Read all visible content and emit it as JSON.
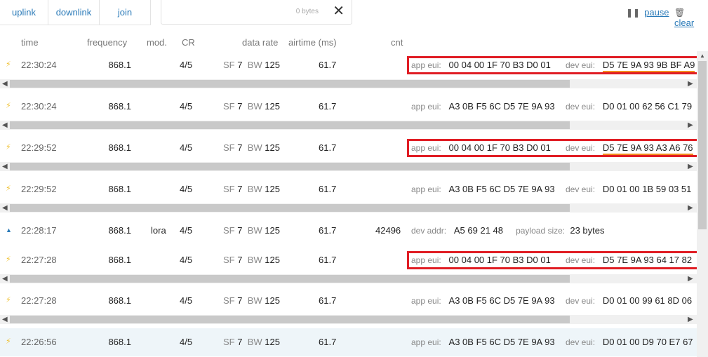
{
  "tabs": [
    {
      "label": "uplink"
    },
    {
      "label": "downlink"
    },
    {
      "label": "join"
    }
  ],
  "filter": {
    "bytes": "0 bytes",
    "clear": "✕"
  },
  "controls": {
    "pause": "pause",
    "clear": "clear"
  },
  "columns": {
    "time": "time",
    "frequency": "frequency",
    "mod": "mod.",
    "cr": "CR",
    "data_rate": "data rate",
    "airtime": "airtime (ms)",
    "cnt": "cnt"
  },
  "labels": {
    "app_eui": "app eui:",
    "dev_eui": "dev eui:",
    "dev_addr": "dev addr:",
    "payload_size": "payload size:",
    "sf": "SF",
    "bw": "BW"
  },
  "rows": [
    {
      "type": "join",
      "time": "22:30:24",
      "freq": "868.1",
      "mod": "",
      "cr": "4/5",
      "sf": "7",
      "bw": "125",
      "airtime": "61.7",
      "cnt": "",
      "app_eui": "00 04 00 1F 70 B3 D0 01",
      "dev_eui": "D5 7E 9A 93 9B BF A9"
    },
    {
      "type": "join",
      "time": "22:30:24",
      "freq": "868.1",
      "mod": "",
      "cr": "4/5",
      "sf": "7",
      "bw": "125",
      "airtime": "61.7",
      "cnt": "",
      "app_eui": "A3 0B F5 6C D5 7E 9A 93",
      "dev_eui": "D0 01 00 62 56 C1 79"
    },
    {
      "type": "join",
      "time": "22:29:52",
      "freq": "868.1",
      "mod": "",
      "cr": "4/5",
      "sf": "7",
      "bw": "125",
      "airtime": "61.7",
      "cnt": "",
      "app_eui": "00 04 00 1F 70 B3 D0 01",
      "dev_eui": "D5 7E 9A 93 A3 A6 76"
    },
    {
      "type": "join",
      "time": "22:29:52",
      "freq": "868.1",
      "mod": "",
      "cr": "4/5",
      "sf": "7",
      "bw": "125",
      "airtime": "61.7",
      "cnt": "",
      "app_eui": "A3 0B F5 6C D5 7E 9A 93",
      "dev_eui": "D0 01 00 1B 59 03 51"
    },
    {
      "type": "uplink",
      "time": "22:28:17",
      "freq": "868.1",
      "mod": "lora",
      "cr": "4/5",
      "sf": "7",
      "bw": "125",
      "airtime": "61.7",
      "cnt": "42496",
      "dev_addr": "A5 69 21 48",
      "payload_size": "23 bytes"
    },
    {
      "type": "join",
      "time": "22:27:28",
      "freq": "868.1",
      "mod": "",
      "cr": "4/5",
      "sf": "7",
      "bw": "125",
      "airtime": "61.7",
      "cnt": "",
      "app_eui": "00 04 00 1F 70 B3 D0 01",
      "dev_eui": "D5 7E 9A 93 64 17 82"
    },
    {
      "type": "join",
      "time": "22:27:28",
      "freq": "868.1",
      "mod": "",
      "cr": "4/5",
      "sf": "7",
      "bw": "125",
      "airtime": "61.7",
      "cnt": "",
      "app_eui": "A3 0B F5 6C D5 7E 9A 93",
      "dev_eui": "D0 01 00 99 61 8D 06"
    },
    {
      "type": "join",
      "time": "22:26:56",
      "freq": "868.1",
      "mod": "",
      "cr": "4/5",
      "sf": "7",
      "bw": "125",
      "airtime": "61.7",
      "cnt": "",
      "app_eui": "A3 0B F5 6C D5 7E 9A 93",
      "dev_eui": "D0 01 00 D9 70 E7 67"
    }
  ],
  "icons": {
    "join": "lightning-icon",
    "uplink": "up-arrow-icon",
    "pause": "pause-icon",
    "clear": "trash-icon"
  },
  "colors": {
    "accent": "#2a7ab8",
    "highlight_box": "#e01d24",
    "underline": "#f28c1d",
    "bolt": "#f0c030"
  }
}
